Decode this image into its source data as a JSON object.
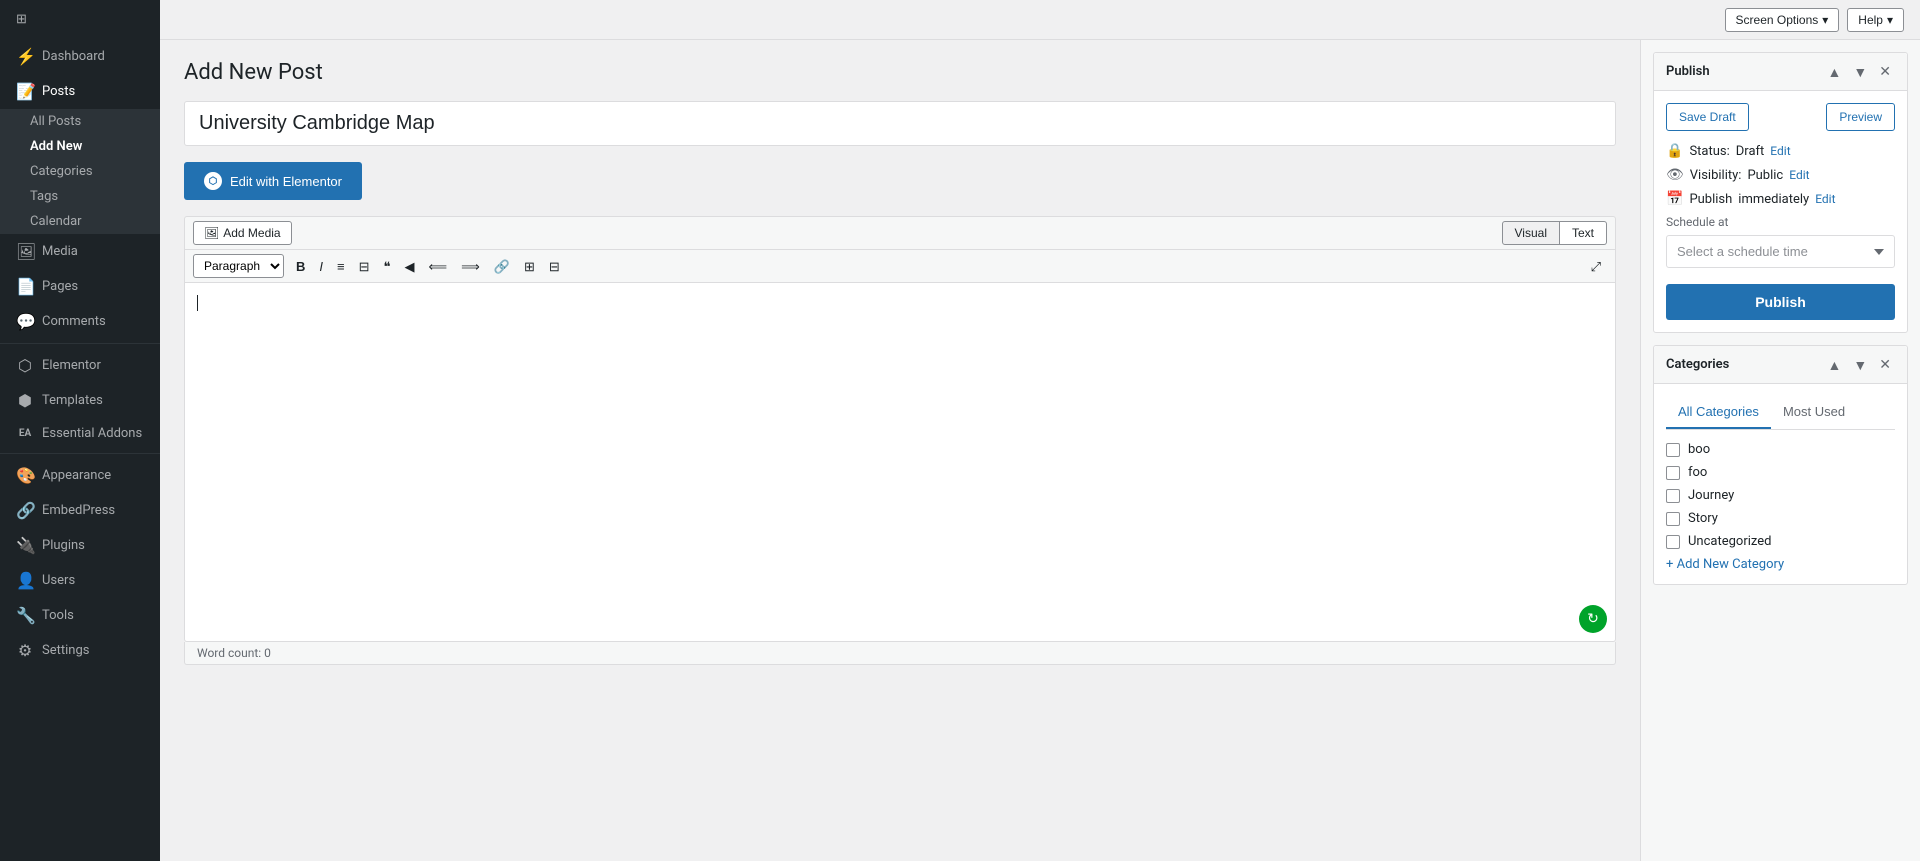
{
  "sidebar": {
    "logo_icon": "⊞",
    "items": [
      {
        "id": "dashboard",
        "label": "Dashboard",
        "icon": "⚡",
        "active": false
      },
      {
        "id": "posts",
        "label": "Posts",
        "icon": "📝",
        "active": true
      },
      {
        "id": "media",
        "label": "Media",
        "icon": "🖼",
        "active": false
      },
      {
        "id": "pages",
        "label": "Pages",
        "icon": "📄",
        "active": false
      },
      {
        "id": "comments",
        "label": "Comments",
        "icon": "💬",
        "active": false
      },
      {
        "id": "elementor",
        "label": "Elementor",
        "icon": "⬡",
        "active": false
      },
      {
        "id": "templates",
        "label": "Templates",
        "icon": "⬢",
        "active": false
      },
      {
        "id": "essential-addons",
        "label": "Essential Addons",
        "icon": "EA",
        "active": false
      },
      {
        "id": "appearance",
        "label": "Appearance",
        "icon": "🎨",
        "active": false
      },
      {
        "id": "embedpress",
        "label": "EmbedPress",
        "icon": "🔗",
        "active": false
      },
      {
        "id": "plugins",
        "label": "Plugins",
        "icon": "🔌",
        "active": false
      },
      {
        "id": "users",
        "label": "Users",
        "icon": "👤",
        "active": false
      },
      {
        "id": "tools",
        "label": "Tools",
        "icon": "🔧",
        "active": false
      },
      {
        "id": "settings",
        "label": "Settings",
        "icon": "⚙",
        "active": false
      }
    ],
    "posts_submenu": [
      {
        "id": "all-posts",
        "label": "All Posts"
      },
      {
        "id": "add-new",
        "label": "Add New",
        "active": true
      },
      {
        "id": "categories",
        "label": "Categories"
      },
      {
        "id": "tags",
        "label": "Tags"
      },
      {
        "id": "calendar",
        "label": "Calendar"
      }
    ]
  },
  "topbar": {
    "screen_options_label": "Screen Options",
    "help_label": "Help"
  },
  "editor": {
    "page_title": "Add New Post",
    "post_title_placeholder": "University Cambridge Map",
    "post_title_value": "University Cambridge Map",
    "elementor_btn_label": "Edit with Elementor",
    "add_media_label": "Add Media",
    "view_visual_label": "Visual",
    "view_text_label": "Text",
    "format_paragraph": "Paragraph",
    "word_count_label": "Word count: 0",
    "toolbar_buttons": [
      "B",
      "I",
      "≡",
      "⊟",
      "❝",
      "←",
      "⟸",
      "⟹",
      "🔗",
      "⊞",
      "⊟"
    ]
  },
  "publish_panel": {
    "title": "Publish",
    "save_draft_label": "Save Draft",
    "preview_label": "Preview",
    "status_label": "Status:",
    "status_value": "Draft",
    "status_edit_label": "Edit",
    "visibility_label": "Visibility:",
    "visibility_value": "Public",
    "visibility_edit_label": "Edit",
    "publish_time_label": "Publish",
    "publish_time_value": "immediately",
    "publish_time_edit_label": "Edit",
    "schedule_at_label": "Schedule at",
    "schedule_placeholder": "Select a schedule time",
    "publish_btn_label": "Publish"
  },
  "categories_panel": {
    "title": "Categories",
    "tab_all": "All Categories",
    "tab_most_used": "Most Used",
    "items": [
      {
        "id": "boo",
        "label": "boo",
        "checked": false
      },
      {
        "id": "foo",
        "label": "foo",
        "checked": false
      },
      {
        "id": "journey",
        "label": "Journey",
        "checked": false
      },
      {
        "id": "story",
        "label": "Story",
        "checked": false
      },
      {
        "id": "uncategorized",
        "label": "Uncategorized",
        "checked": false
      }
    ],
    "add_new_label": "+ Add New Category"
  }
}
